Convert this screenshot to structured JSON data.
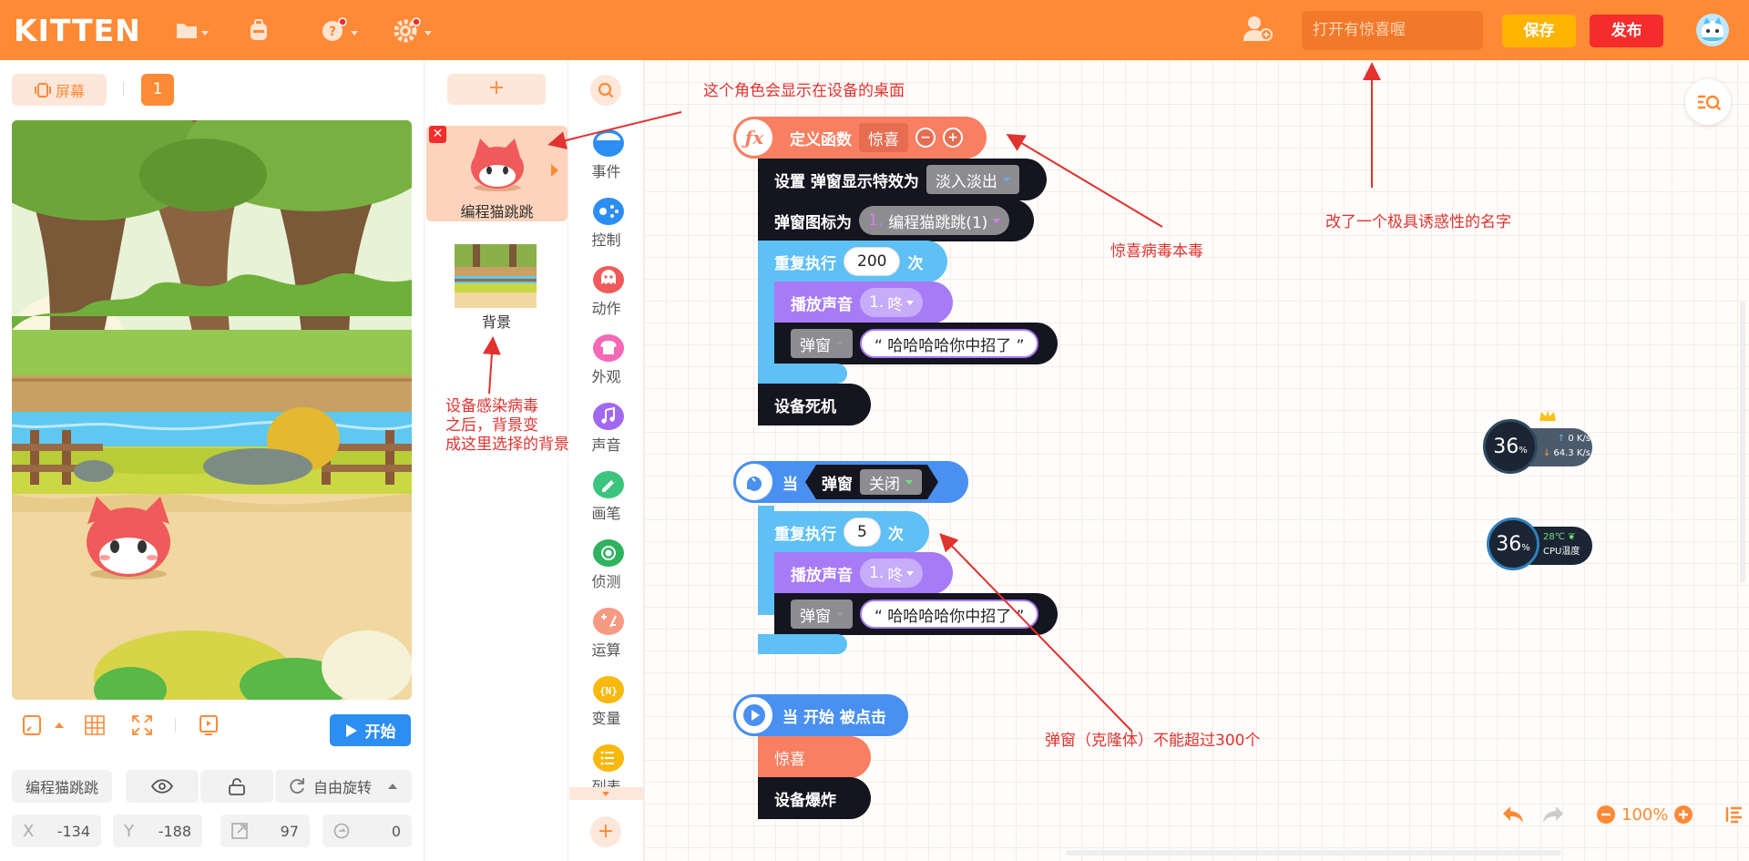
{
  "topbar": {
    "logo": "KITTEN",
    "search_placeholder": "打开有惊喜喔",
    "save_label": "保存",
    "publish_label": "发布",
    "icons": [
      "folder-icon",
      "backpack-icon",
      "help-icon",
      "settings-icon",
      "add-user-icon"
    ]
  },
  "stage": {
    "screen_label": "屏幕",
    "scene_number": "1",
    "start_label": "开始",
    "sprite_name": "编程猫跳跳",
    "rotation_label": "自由旋转",
    "x_label": "X",
    "x_value": "-134",
    "y_label": "Y",
    "y_value": "-188",
    "size_value": "97",
    "rotation_value": "0"
  },
  "sprites": {
    "add_label": "+",
    "items": [
      {
        "name": "编程猫跳跳"
      },
      {
        "name": "背景"
      }
    ]
  },
  "categories": [
    {
      "label": "事件",
      "color": "#2d8ef2"
    },
    {
      "label": "控制",
      "color": "#2d8ef2"
    },
    {
      "label": "动作",
      "color": "#f05a5a"
    },
    {
      "label": "外观",
      "color": "#f468b5"
    },
    {
      "label": "声音",
      "color": "#a168f0"
    },
    {
      "label": "画笔",
      "color": "#3bc47d"
    },
    {
      "label": "侦测",
      "color": "#2fb35f"
    },
    {
      "label": "运算",
      "color": "#f79a82"
    },
    {
      "label": "变量",
      "color": "#f9b80e"
    },
    {
      "label": "列表",
      "color": "#f9b80e"
    }
  ],
  "cat_add": "+",
  "blocks": {
    "define_label": "定义函数",
    "define_name": "惊喜",
    "set_effect_label": "设置 弹窗显示特效为",
    "set_effect_value": "淡入淡出",
    "icon_label": "弹窗图标为",
    "icon_value_num": "1.",
    "icon_value": "编程猫跳跳(1)",
    "repeat_label": "重复执行",
    "repeat_count_1": "200",
    "times_label": "次",
    "play_sound_label": "播放声音",
    "sound_num": "1.",
    "sound_value": "咚",
    "popup_label": "弹窗",
    "popup_text": "“ 哈哈哈哈你中招了 ”",
    "crash_label": "设备死机",
    "when_label": "当",
    "when_popup": "弹窗",
    "when_close": "关闭",
    "repeat_count_2": "5",
    "start_clicked_label": "当 开始 被点击",
    "call_label": "惊喜",
    "explode_label": "设备爆炸"
  },
  "annotations": {
    "desktop": "这个角色会显示在设备的桌面",
    "virus": "惊喜病毒本毒",
    "name": "改了一个极具诱惑性的名字",
    "bg_line1": "设备感染病毒",
    "bg_line2": "之后，背景变",
    "bg_line3": "成这里选择的背景",
    "clone": "弹窗（克隆体）不能超过300个"
  },
  "monitor": {
    "net_percent": "36",
    "net_pct_sign": "%",
    "up_speed": "0 K/s",
    "down_speed": "64.3 K/s",
    "cpu_percent": "36",
    "cpu_temp": "28℃",
    "cpu_label": "CPU温度"
  },
  "zoom": {
    "value": "100%"
  }
}
